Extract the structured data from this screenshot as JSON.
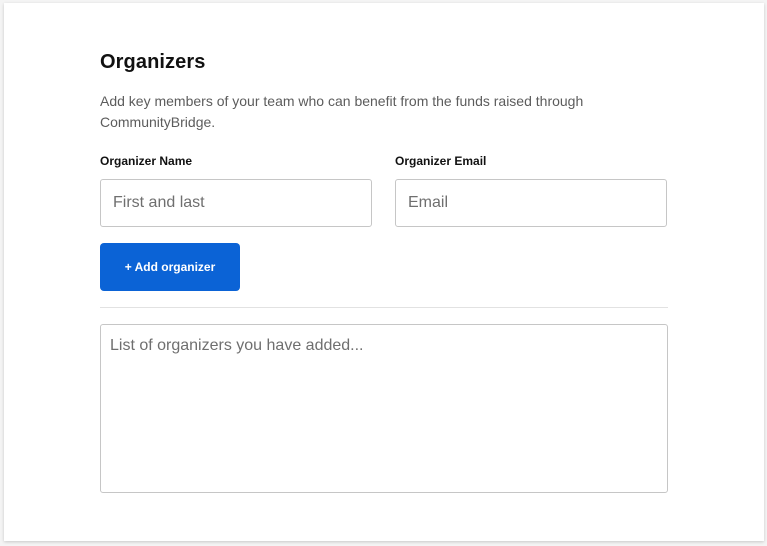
{
  "organizers": {
    "title": "Organizers",
    "description": "Add key members of your team who can benefit from the funds raised through CommunityBridge.",
    "name_field": {
      "label": "Organizer Name",
      "value": "",
      "placeholder": "First and last"
    },
    "email_field": {
      "label": "Organizer Email",
      "value": "",
      "placeholder": "Email"
    },
    "add_button_label": "+ Add organizer",
    "list": {
      "value": "",
      "placeholder": "List of organizers you have added..."
    }
  },
  "colors": {
    "accent": "#0b63d6",
    "border": "#c6c6c6",
    "divider": "#e2e2e2"
  }
}
